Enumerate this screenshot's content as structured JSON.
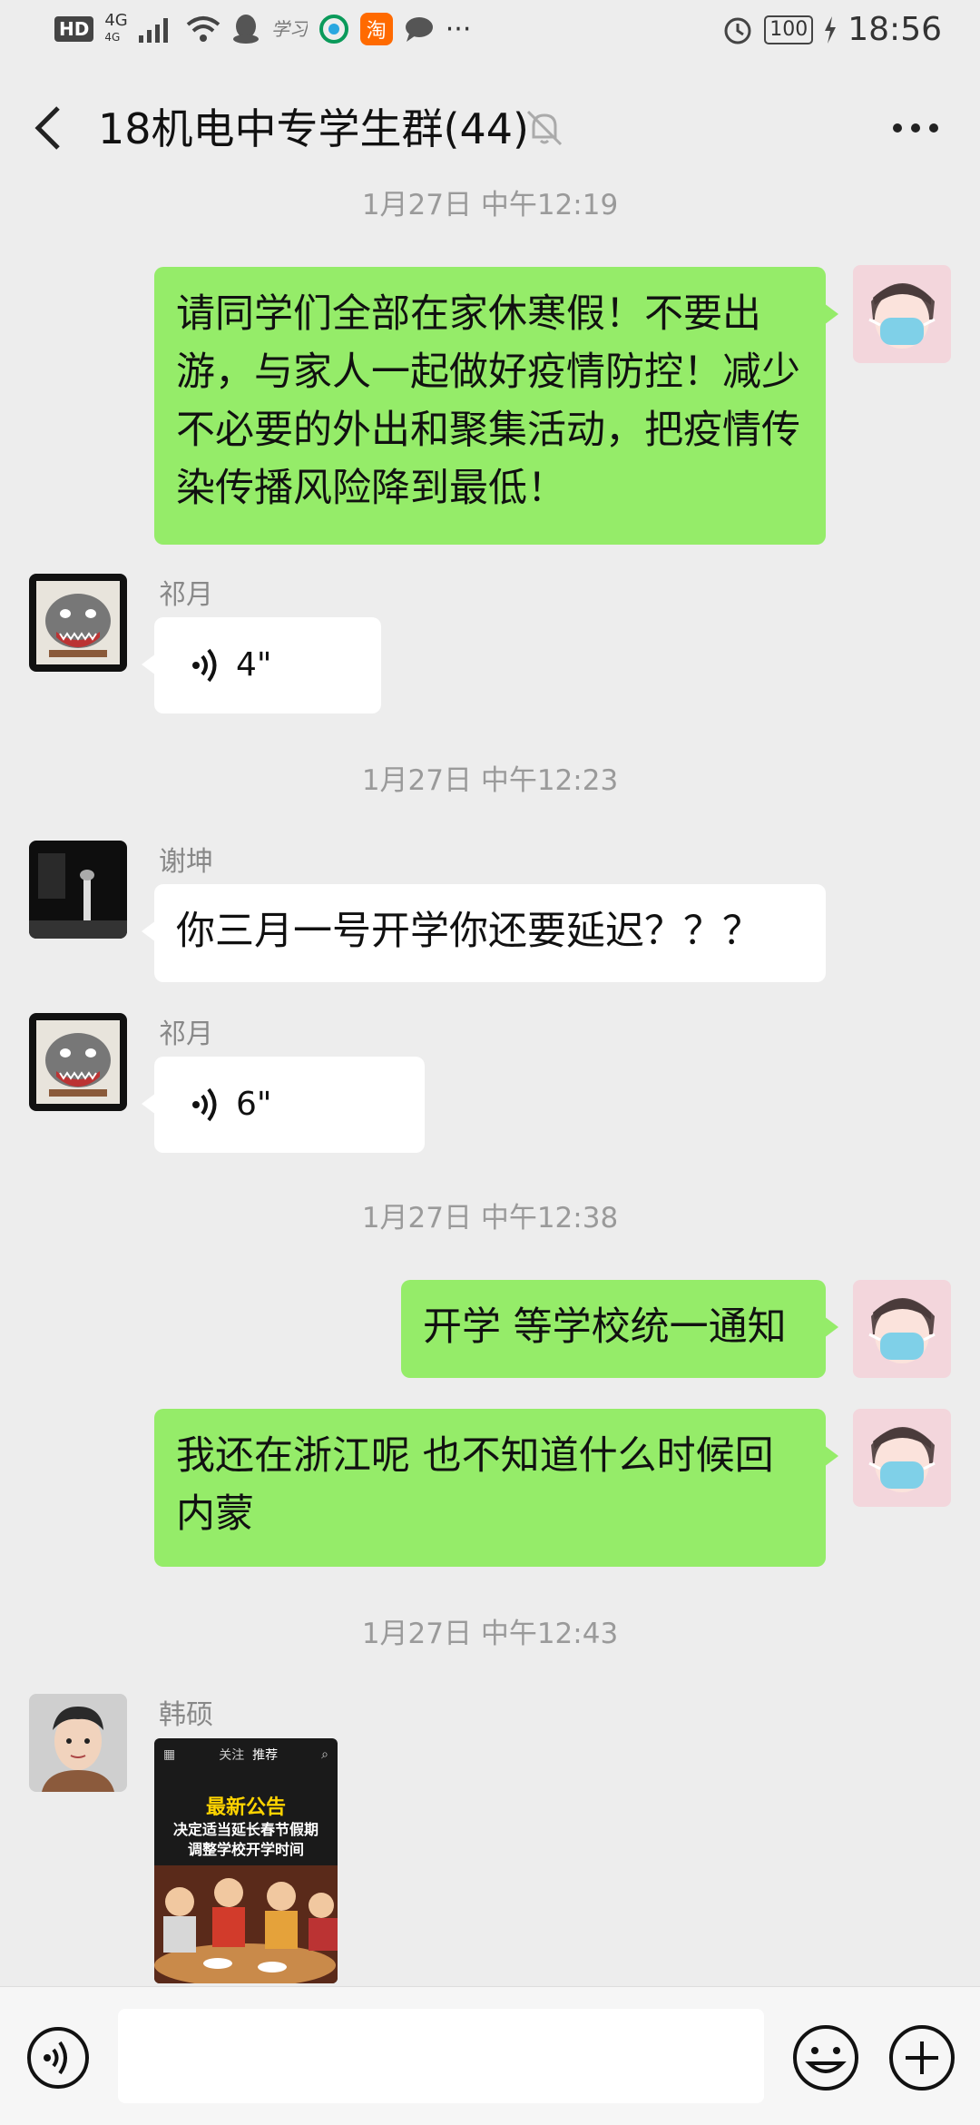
{
  "status_bar": {
    "hd": "HD",
    "network": "4G",
    "network_sub": "4G",
    "app_badge": "淘",
    "dots": "···",
    "battery": "100",
    "time": "18:56",
    "icons": [
      "signal-icon",
      "wifi-icon",
      "qq-icon",
      "study-icon",
      "mobile-icon",
      "taobao-icon",
      "message-icon",
      "alarm-icon",
      "battery-icon"
    ]
  },
  "header": {
    "title": "18机电中专学生群(44)",
    "icons": [
      "back-icon",
      "mute-icon",
      "more-icon"
    ]
  },
  "messages": [
    {
      "type": "timestamp",
      "text": "1月27日 中午12:19"
    },
    {
      "type": "text",
      "side": "right",
      "text": "请同学们全部在家休寒假！不要出游，与家人一起做好疫情防控！减少不必要的外出和聚集活动，把疫情传染传播风险降到最低！"
    },
    {
      "type": "voice",
      "side": "left",
      "sender": "祁月",
      "duration": "4\""
    },
    {
      "type": "timestamp",
      "text": "1月27日 中午12:23"
    },
    {
      "type": "text",
      "side": "left",
      "sender": "谢坤",
      "text": "你三月一号开学你还要延迟？？？"
    },
    {
      "type": "voice",
      "side": "left",
      "sender": "祁月",
      "duration": "6\""
    },
    {
      "type": "timestamp",
      "text": "1月27日 中午12:38"
    },
    {
      "type": "text",
      "side": "right",
      "text": "开学 等学校统一通知"
    },
    {
      "type": "text",
      "side": "right",
      "text": "我还在浙江呢 也不知道什么时候回内蒙"
    },
    {
      "type": "timestamp",
      "text": "1月27日 中午12:43"
    },
    {
      "type": "image",
      "side": "left",
      "sender": "韩硕",
      "image_text": {
        "tab1": "关注",
        "tab2": "推荐",
        "title": "最新公告",
        "line1": "决定适当延长春节假期",
        "line2": "调整学校开学时间"
      }
    }
  ],
  "input_bar": {
    "icons": [
      "voice-input-icon",
      "emoji-icon",
      "plus-icon"
    ]
  },
  "colors": {
    "background": "#ededed",
    "my_bubble": "#95ec69",
    "other_bubble": "#ffffff",
    "timestamp": "#9a9a9a"
  }
}
